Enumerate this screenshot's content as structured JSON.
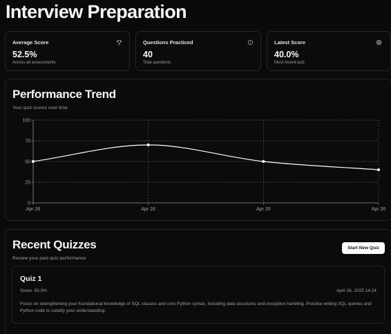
{
  "page": {
    "title": "Interview Preparation"
  },
  "stats": [
    {
      "title": "Average Score",
      "value": "52.5%",
      "subtitle": "Across all assessments",
      "icon": "trophy-icon"
    },
    {
      "title": "Questions Practiced",
      "value": "40",
      "subtitle": "Total questions",
      "icon": "info-icon"
    },
    {
      "title": "Latest Score",
      "value": "40.0%",
      "subtitle": "Most recent quiz",
      "icon": "target-icon"
    }
  ],
  "performance": {
    "title": "Performance Trend",
    "subtitle": "Your quiz scores over time"
  },
  "chart_data": {
    "type": "line",
    "categories": [
      "Apr 26",
      "Apr 26",
      "Apr 26",
      "Apr 26"
    ],
    "series": [
      {
        "values": [
          50,
          70,
          50,
          40
        ]
      }
    ],
    "yticks": [
      "100",
      "75",
      "50",
      "25",
      "0"
    ],
    "ylim": [
      0,
      100
    ],
    "grid": true,
    "line_color": "#ffffff"
  },
  "recent": {
    "title": "Recent Quizzes",
    "subtitle": "Review your past quiz performance",
    "new_quiz_label": "Start New Quiz",
    "quizzes": [
      {
        "title": "Quiz 1",
        "score": "Score: 50.0%",
        "date": "April 26, 2025 14:24",
        "description": "Focus on strengthening your foundational knowledge of SQL clauses and core Python syntax, including data structures and exception handling. Practice writing SQL queries and Python code to solidify your understanding."
      }
    ]
  }
}
